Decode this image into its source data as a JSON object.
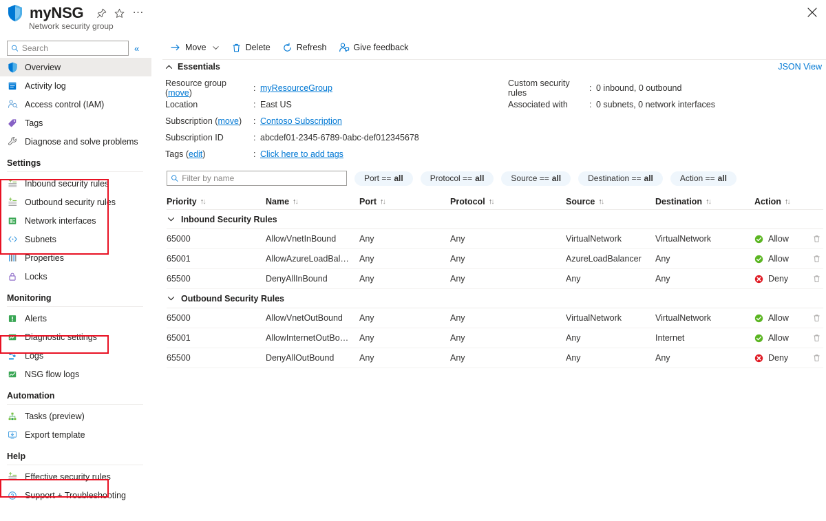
{
  "header": {
    "title": "myNSG",
    "subtitle": "Network security group",
    "pin_icon": "pin-icon",
    "favorite_icon": "star-icon",
    "more_icon": "ellipsis-icon",
    "close_icon": "close-icon"
  },
  "sidebar": {
    "search": {
      "placeholder": "Search",
      "value": "",
      "icon": "search-icon"
    },
    "collapse_label": "«",
    "items": [
      {
        "label": "Overview",
        "icon": "shield-icon",
        "selected": true,
        "type": "item"
      },
      {
        "label": "Activity log",
        "icon": "activity-log-icon",
        "selected": false,
        "type": "item"
      },
      {
        "label": "Access control (IAM)",
        "icon": "access-control-icon",
        "selected": false,
        "type": "item"
      },
      {
        "label": "Tags",
        "icon": "tag-icon",
        "selected": false,
        "type": "item"
      },
      {
        "label": "Diagnose and solve problems",
        "icon": "wrench-icon",
        "selected": false,
        "type": "item"
      },
      {
        "label": "Settings",
        "type": "group"
      },
      {
        "label": "Inbound security rules",
        "icon": "inbound-rules-icon",
        "selected": false,
        "type": "item"
      },
      {
        "label": "Outbound security rules",
        "icon": "outbound-rules-icon",
        "selected": false,
        "type": "item"
      },
      {
        "label": "Network interfaces",
        "icon": "network-interface-icon",
        "selected": false,
        "type": "item"
      },
      {
        "label": "Subnets",
        "icon": "subnets-icon",
        "selected": false,
        "type": "item"
      },
      {
        "label": "Properties",
        "icon": "properties-icon",
        "selected": false,
        "type": "item"
      },
      {
        "label": "Locks",
        "icon": "lock-icon",
        "selected": false,
        "type": "item"
      },
      {
        "label": "Monitoring",
        "type": "group"
      },
      {
        "label": "Alerts",
        "icon": "alerts-icon",
        "selected": false,
        "type": "item"
      },
      {
        "label": "Diagnostic settings",
        "icon": "diagnostic-settings-icon",
        "selected": false,
        "type": "item"
      },
      {
        "label": "Logs",
        "icon": "logs-icon",
        "selected": false,
        "type": "item"
      },
      {
        "label": "NSG flow logs",
        "icon": "nsg-flow-logs-icon",
        "selected": false,
        "type": "item"
      },
      {
        "label": "Automation",
        "type": "group"
      },
      {
        "label": "Tasks (preview)",
        "icon": "tasks-icon",
        "selected": false,
        "type": "item"
      },
      {
        "label": "Export template",
        "icon": "export-template-icon",
        "selected": false,
        "type": "item"
      },
      {
        "label": "Help",
        "type": "group"
      },
      {
        "label": "Effective security rules",
        "icon": "effective-rules-icon",
        "selected": false,
        "type": "item"
      },
      {
        "label": "Support + Troubleshooting",
        "icon": "support-icon",
        "selected": false,
        "type": "item"
      }
    ],
    "highlight_color": "#e81123"
  },
  "toolbar": {
    "move_label": "Move",
    "delete_label": "Delete",
    "refresh_label": "Refresh",
    "feedback_label": "Give feedback"
  },
  "essentials": {
    "section_label": "Essentials",
    "json_view_label": "JSON View",
    "left": [
      {
        "key": "Resource group",
        "key_link": "move",
        "value": "myResourceGroup",
        "value_is_link": true
      },
      {
        "key": "Location",
        "key_link": "",
        "value": "East US",
        "value_is_link": false
      },
      {
        "key": "Subscription",
        "key_link": "move",
        "value": "Contoso Subscription",
        "value_is_link": true
      },
      {
        "key": "Subscription ID",
        "key_link": "",
        "value": "abcdef01-2345-6789-0abc-def012345678",
        "value_is_link": false
      },
      {
        "key": "Tags",
        "key_link": "edit",
        "value": "Click here to add tags",
        "value_is_link": true
      }
    ],
    "right": [
      {
        "key": "Custom security rules",
        "value": "0 inbound, 0 outbound"
      },
      {
        "key": "Associated with",
        "value": "0 subnets, 0 network interfaces"
      }
    ]
  },
  "filters": {
    "name_filter": {
      "placeholder": "Filter by name",
      "value": "",
      "icon": "search-icon"
    },
    "pills": [
      {
        "field": "Port ==",
        "value": "all"
      },
      {
        "field": "Protocol ==",
        "value": "all"
      },
      {
        "field": "Source ==",
        "value": "all"
      },
      {
        "field": "Destination ==",
        "value": "all"
      },
      {
        "field": "Action ==",
        "value": "all"
      }
    ]
  },
  "table": {
    "columns": [
      "Priority",
      "Name",
      "Port",
      "Protocol",
      "Source",
      "Destination",
      "Action"
    ],
    "groups": [
      {
        "label": "Inbound Security Rules",
        "rows": [
          {
            "priority": "65000",
            "name": "AllowVnetInBound",
            "port": "Any",
            "protocol": "Any",
            "source": "VirtualNetwork",
            "destination": "VirtualNetwork",
            "action": "Allow"
          },
          {
            "priority": "65001",
            "name": "AllowAzureLoadBalanc···",
            "port": "Any",
            "protocol": "Any",
            "source": "AzureLoadBalancer",
            "destination": "Any",
            "action": "Allow"
          },
          {
            "priority": "65500",
            "name": "DenyAllInBound",
            "port": "Any",
            "protocol": "Any",
            "source": "Any",
            "destination": "Any",
            "action": "Deny"
          }
        ]
      },
      {
        "label": "Outbound Security Rules",
        "rows": [
          {
            "priority": "65000",
            "name": "AllowVnetOutBound",
            "port": "Any",
            "protocol": "Any",
            "source": "VirtualNetwork",
            "destination": "VirtualNetwork",
            "action": "Allow"
          },
          {
            "priority": "65001",
            "name": "AllowInternetOutBound",
            "port": "Any",
            "protocol": "Any",
            "source": "Any",
            "destination": "Internet",
            "action": "Allow"
          },
          {
            "priority": "65500",
            "name": "DenyAllOutBound",
            "port": "Any",
            "protocol": "Any",
            "source": "Any",
            "destination": "Any",
            "action": "Deny"
          }
        ]
      }
    ],
    "allow_color": "#5bb522",
    "deny_color": "#e01b24",
    "delete_icon": "trash-icon"
  }
}
